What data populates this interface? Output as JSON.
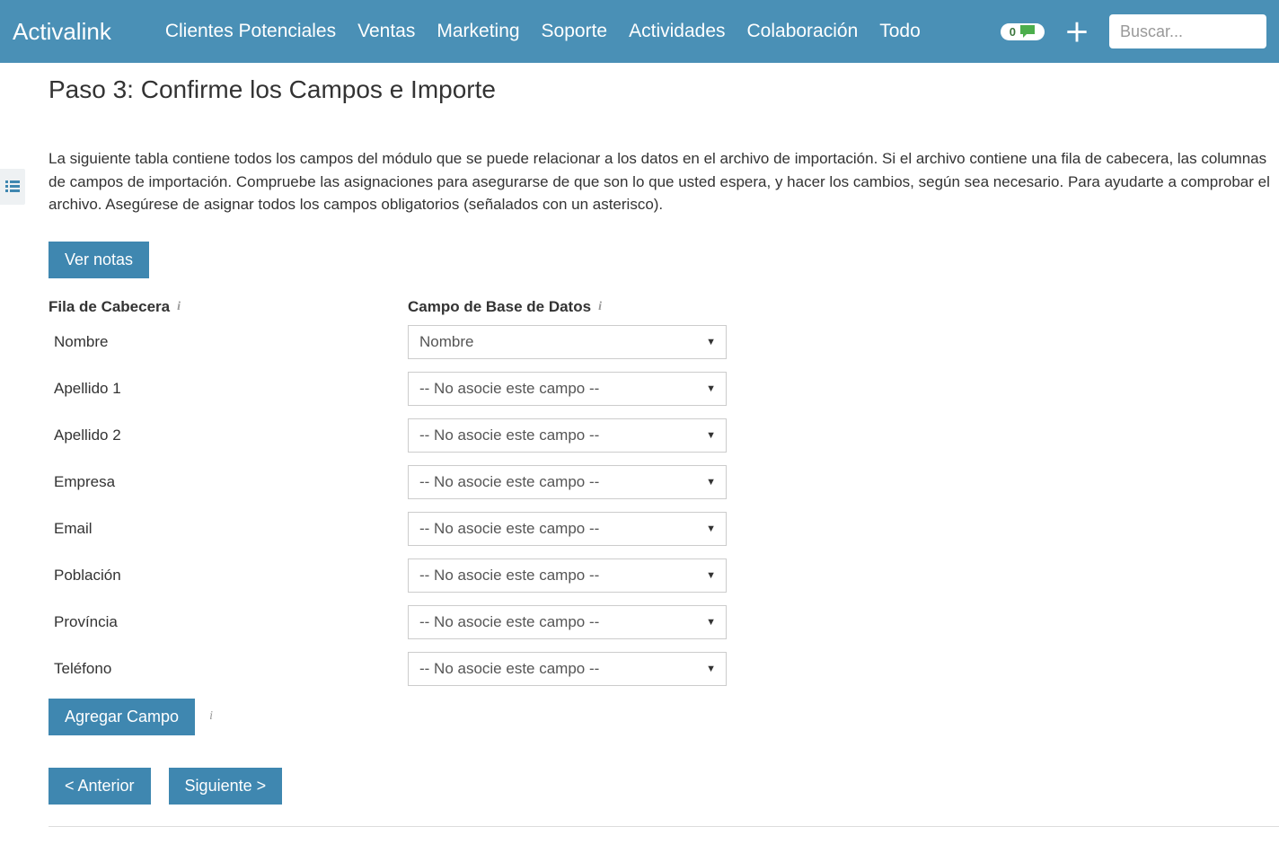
{
  "brand": "Activalink",
  "nav": {
    "items": [
      "Clientes Potenciales",
      "Ventas",
      "Marketing",
      "Soporte",
      "Actividades",
      "Colaboración",
      "Todo"
    ]
  },
  "badge_count": "0",
  "search": {
    "placeholder": "Buscar..."
  },
  "page": {
    "title": "Paso 3: Confirme los Campos e Importe",
    "intro": "La siguiente tabla contiene todos los campos del módulo que se puede relacionar a los datos en el archivo de importación. Si el archivo contiene una fila de cabecera, las columnas de campos de importación. Compruebe las asignaciones para asegurarse de que son lo que usted espera, y hacer los cambios, según sea necesario. Para ayudarte a comprobar el archivo. Asegúrese de asignar todos los campos obligatorios (señalados con un asterisco)."
  },
  "buttons": {
    "ver_notas": "Ver notas",
    "agregar_campo": "Agregar Campo",
    "anterior": "< Anterior",
    "siguiente": "Siguiente >"
  },
  "table": {
    "header1": "Fila de Cabecera",
    "header2": "Campo de Base de Datos"
  },
  "no_associate": "-- No asocie este campo --",
  "fields": [
    {
      "label": "Nombre",
      "selected": "Nombre"
    },
    {
      "label": "Apellido 1",
      "selected": "-- No asocie este campo --"
    },
    {
      "label": "Apellido 2",
      "selected": "-- No asocie este campo --"
    },
    {
      "label": "Empresa",
      "selected": "-- No asocie este campo --"
    },
    {
      "label": "Email",
      "selected": "-- No asocie este campo --"
    },
    {
      "label": "Población",
      "selected": "-- No asocie este campo --"
    },
    {
      "label": "Província",
      "selected": "-- No asocie este campo --"
    },
    {
      "label": "Teléfono",
      "selected": "-- No asocie este campo --"
    }
  ]
}
